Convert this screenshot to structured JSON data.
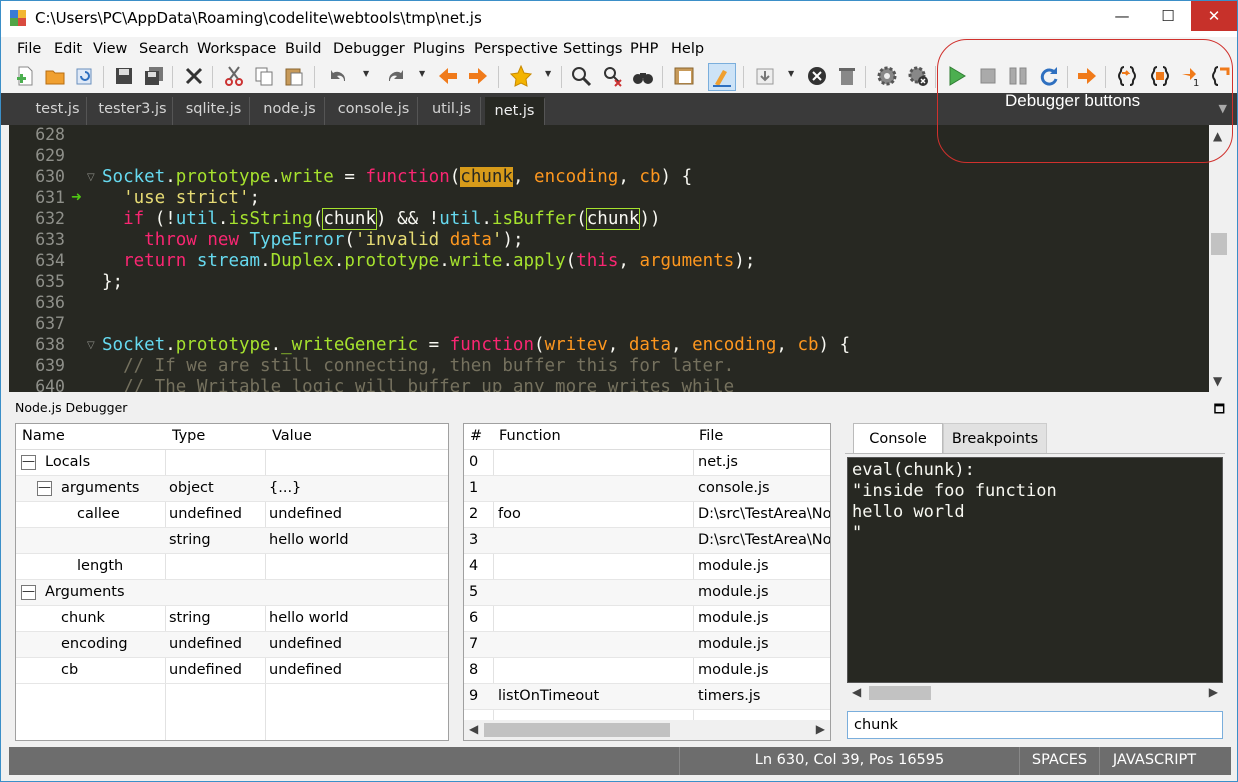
{
  "window": {
    "title": "C:\\Users\\PC\\AppData\\Roaming\\codelite\\webtools\\tmp\\net.js",
    "minimize_glyph": "—",
    "maximize_glyph": "☐",
    "close_glyph": "✕"
  },
  "menu": [
    "File",
    "Edit",
    "View",
    "Search",
    "Workspace",
    "Build",
    "Debugger",
    "Plugins",
    "Perspective",
    "Settings",
    "PHP",
    "Help"
  ],
  "toolbar_icons": [
    "new-file-icon",
    "open-folder-icon",
    "reload-icon",
    "save-icon",
    "save-all-icon",
    "close-icon",
    "cut-icon",
    "copy-icon",
    "paste-icon",
    "undo-icon",
    "redo-icon",
    "back-icon",
    "forward-icon",
    "bookmark-icon",
    "find-icon",
    "find-replace-icon",
    "find-in-files-icon",
    "workspace-icon",
    "highlight-icon",
    "download-icon",
    "stop-build-icon",
    "clean-icon",
    "settings-gear-icon",
    "settings-stop-icon",
    "debug-start-icon",
    "debug-stop-icon",
    "debug-pause-icon",
    "debug-restart-icon",
    "debug-show-next-icon",
    "step-in-icon",
    "step-over-icon",
    "step-out-icon",
    "step-into-instruction-icon"
  ],
  "annotation": {
    "label": "Debugger buttons",
    "color": "#d0312d"
  },
  "tabs": [
    {
      "label": "test.js",
      "active": false
    },
    {
      "label": "tester3.js",
      "active": false
    },
    {
      "label": "sqlite.js",
      "active": false
    },
    {
      "label": "node.js",
      "active": false
    },
    {
      "label": "console.js",
      "active": false
    },
    {
      "label": "util.js",
      "active": false
    },
    {
      "label": "net.js",
      "active": true
    }
  ],
  "editor": {
    "line_numbers": [
      "628",
      "629",
      "630",
      "631",
      "632",
      "633",
      "634",
      "635",
      "636",
      "637",
      "638",
      "639",
      "640"
    ],
    "current_line": "631",
    "lines": [
      "",
      "",
      "Socket.prototype.write = function(chunk, encoding, cb) {",
      "  'use strict';",
      "  if (!util.isString(chunk) && !util.isBuffer(chunk))",
      "    throw new TypeError('invalid data');",
      "  return stream.Duplex.prototype.write.apply(this, arguments);",
      "};",
      "",
      "",
      "Socket.prototype._writeGeneric = function(writev, data, encoding, cb) {",
      "  // If we are still connecting, then buffer this for later.",
      "  // The Writable logic will buffer up any more writes while"
    ]
  },
  "debugger_panel": {
    "title": "Node.js Debugger",
    "locals": {
      "headers": [
        "Name",
        "Type",
        "Value"
      ],
      "rows": [
        {
          "name": "Locals",
          "type": "",
          "value": "",
          "level": 0,
          "expander": "—"
        },
        {
          "name": "arguments",
          "type": "object",
          "value": "{...}",
          "level": 1,
          "expander": "—"
        },
        {
          "name": "callee",
          "type": "undefined",
          "value": "undefined",
          "level": 2,
          "expander": ""
        },
        {
          "name": "",
          "type": "string",
          "value": "hello world",
          "level": 2,
          "expander": ""
        },
        {
          "name": "length",
          "type": "",
          "value": "",
          "level": 2,
          "expander": ""
        },
        {
          "name": "Arguments",
          "type": "",
          "value": "",
          "level": 0,
          "expander": "—"
        },
        {
          "name": "chunk",
          "type": "string",
          "value": "hello world",
          "level": 1,
          "expander": ""
        },
        {
          "name": "encoding",
          "type": "undefined",
          "value": "undefined",
          "level": 1,
          "expander": ""
        },
        {
          "name": "cb",
          "type": "undefined",
          "value": "undefined",
          "level": 1,
          "expander": ""
        }
      ]
    },
    "callstack": {
      "headers": [
        "#",
        "Function",
        "File"
      ],
      "rows": [
        {
          "num": "0",
          "func": "",
          "file": "net.js"
        },
        {
          "num": "1",
          "func": "",
          "file": "console.js"
        },
        {
          "num": "2",
          "func": "foo",
          "file": "D:\\src\\TestArea\\Nod"
        },
        {
          "num": "3",
          "func": "",
          "file": "D:\\src\\TestArea\\Nod"
        },
        {
          "num": "4",
          "func": "",
          "file": "module.js"
        },
        {
          "num": "5",
          "func": "",
          "file": "module.js"
        },
        {
          "num": "6",
          "func": "",
          "file": "module.js"
        },
        {
          "num": "7",
          "func": "",
          "file": "module.js"
        },
        {
          "num": "8",
          "func": "",
          "file": "module.js"
        },
        {
          "num": "9",
          "func": "listOnTimeout",
          "file": "timers.js"
        }
      ]
    },
    "right_tabs": [
      {
        "label": "Console",
        "active": true
      },
      {
        "label": "Breakpoints",
        "active": false
      }
    ],
    "console_lines": [
      "eval(chunk):",
      "\"inside foo function",
      "hello world",
      "\""
    ],
    "console_input": "chunk"
  },
  "statusbar": {
    "position": "Ln 630, Col 39, Pos 16595",
    "indent": "SPACES",
    "language": "JAVASCRIPT"
  }
}
